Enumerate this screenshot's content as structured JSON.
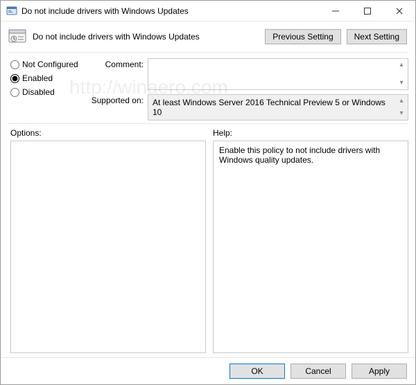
{
  "titlebar": {
    "title": "Do not include drivers with Windows Updates"
  },
  "header": {
    "title": "Do not include drivers with Windows Updates",
    "prev_label": "Previous Setting",
    "next_label": "Next Setting"
  },
  "radios": {
    "not_configured": "Not Configured",
    "enabled": "Enabled",
    "disabled": "Disabled",
    "selected": "enabled"
  },
  "fields": {
    "comment_label": "Comment:",
    "comment_value": "",
    "supported_label": "Supported on:",
    "supported_value": "At least Windows Server 2016 Technical Preview 5 or Windows 10"
  },
  "panes": {
    "options_label": "Options:",
    "options_value": "",
    "help_label": "Help:",
    "help_value": "Enable this policy to not include drivers with Windows quality updates."
  },
  "footer": {
    "ok": "OK",
    "cancel": "Cancel",
    "apply": "Apply"
  },
  "watermark": "http://winaero.com"
}
